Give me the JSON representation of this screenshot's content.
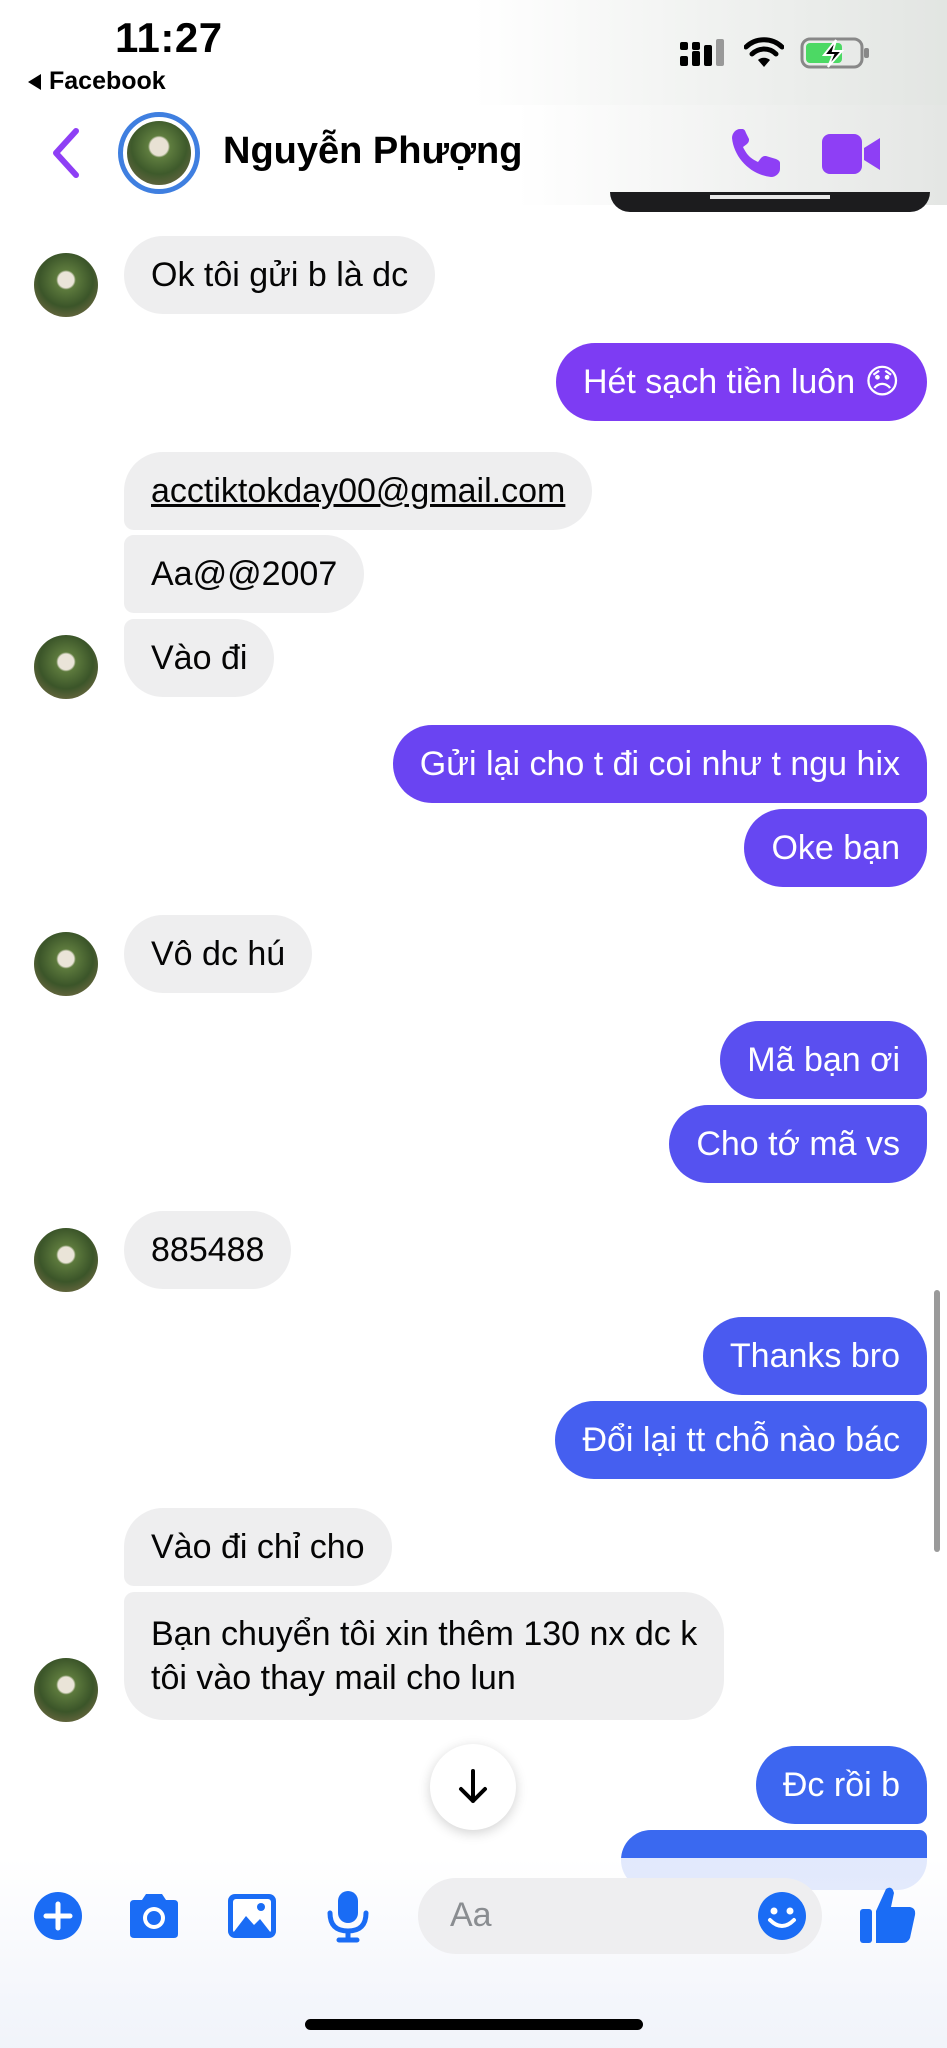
{
  "status_bar": {
    "time": "11:27",
    "back_app": "Facebook"
  },
  "header": {
    "contact_name": "Nguyễn Phượng"
  },
  "messages": [
    {
      "side": "in",
      "text": "Ok tôi gửi b là dc"
    },
    {
      "side": "out",
      "text": "Hét sạch tiền luôn 😞"
    },
    {
      "side": "in",
      "text": "acctiktokday00@gmail.com"
    },
    {
      "side": "in",
      "text": "Aa@@2007"
    },
    {
      "side": "in",
      "text": "Vào đi"
    },
    {
      "side": "out",
      "text": "Gửi lại cho t đi coi như t ngu hix"
    },
    {
      "side": "out",
      "text": "Oke bạn"
    },
    {
      "side": "in",
      "text": "Vô dc hú"
    },
    {
      "side": "out",
      "text": "Mã bạn ơi"
    },
    {
      "side": "out",
      "text": "Cho tớ mã vs"
    },
    {
      "side": "in",
      "text": "885488"
    },
    {
      "side": "out",
      "text": "Thanks bro"
    },
    {
      "side": "out",
      "text": "Đổi lại tt chỗ nào bác"
    },
    {
      "side": "in",
      "text": "Vào đi chỉ cho"
    },
    {
      "side": "in",
      "lines": [
        "Bạn chuyển tôi xin thêm 130 nx dc k",
        "tôi vào thay mail cho lun"
      ]
    },
    {
      "side": "out",
      "text": "Đc rồi b"
    }
  ],
  "composer": {
    "placeholder": "Aa"
  },
  "icons": {
    "back": "chevron-left-icon",
    "call": "phone-icon",
    "video": "video-camera-icon",
    "add": "plus-circle-icon",
    "camera": "camera-icon",
    "gallery": "image-icon",
    "mic": "microphone-icon",
    "emoji": "smile-icon",
    "like": "thumbs-up-icon",
    "scroll_down": "arrow-down-icon"
  },
  "colors": {
    "accent_purple": "#8e3ff5",
    "outgoing_top": "#7d3cf3",
    "outgoing_mid": "#5b4ff0",
    "outgoing_bottom": "#3d66f0",
    "incoming": "#eeeeef",
    "composer_icons": "#1a6cf5"
  }
}
